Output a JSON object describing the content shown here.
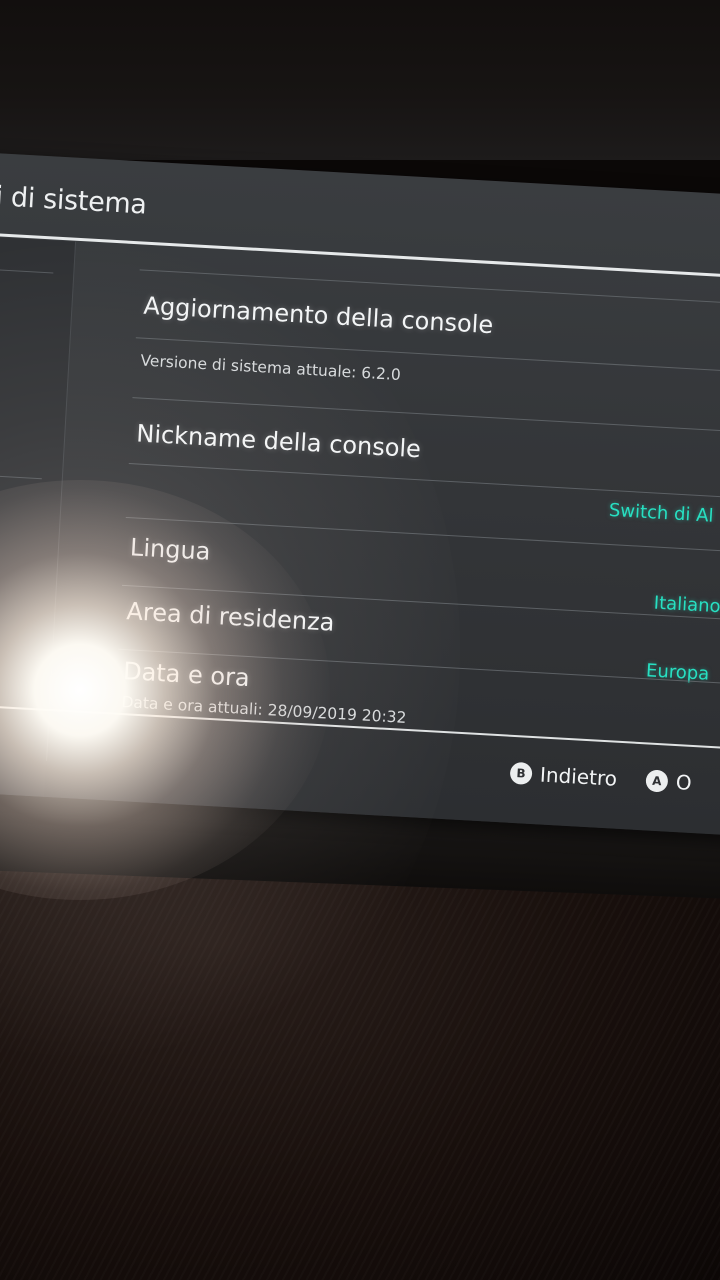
{
  "screen": {
    "title": "i di sistema",
    "items": [
      {
        "title": "Aggiornamento della console",
        "subtitle": "Versione di sistema attuale: 6.2.0"
      },
      {
        "title": "Nickname della console",
        "value": "Switch di Al"
      },
      {
        "title": "Lingua",
        "value": "Italiano"
      },
      {
        "title": "Area di residenza",
        "value": "Europa"
      },
      {
        "title": "Data e ora",
        "subtitle": "Data e ora attuali: 28/09/2019 20:32"
      }
    ],
    "footer": {
      "back_button_glyph": "B",
      "back_label": "Indietro",
      "ok_button_glyph": "A",
      "ok_label": "O"
    }
  },
  "colors": {
    "screen_bg": "#333538",
    "accent_value": "#27e0c2",
    "text": "#f3f5f6"
  }
}
